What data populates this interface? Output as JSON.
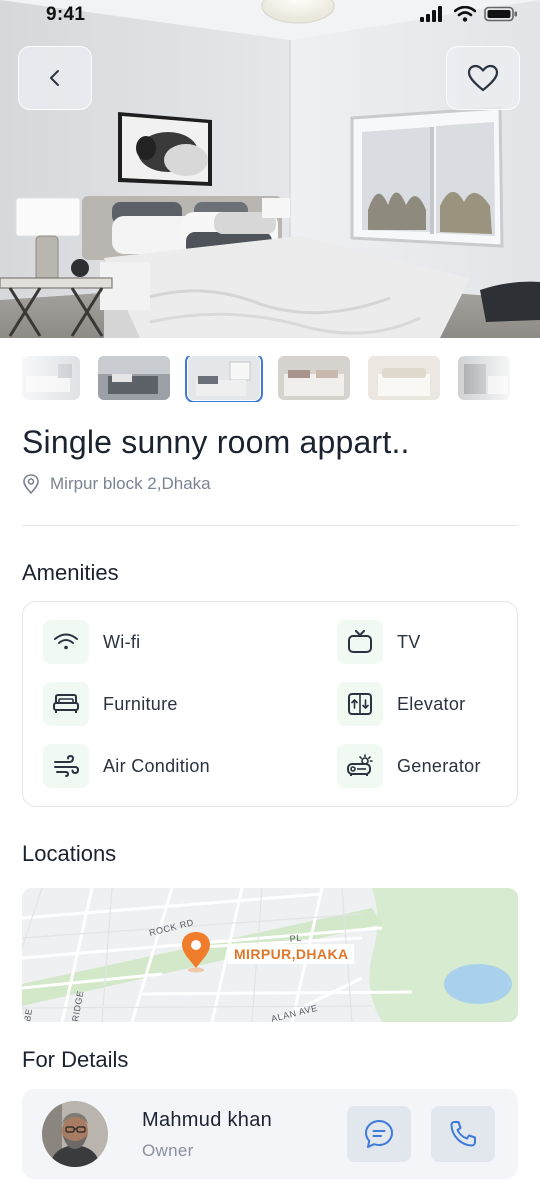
{
  "status": {
    "time": "9:41"
  },
  "listing": {
    "title": "Single sunny room appart..",
    "location": "Mirpur block 2,Dhaka"
  },
  "amenities": {
    "title": "Amenities",
    "items": [
      {
        "label": "Wi-fi",
        "icon": "wifi-icon"
      },
      {
        "label": "TV",
        "icon": "tv-icon"
      },
      {
        "label": "Furniture",
        "icon": "bed-icon"
      },
      {
        "label": "Elevator",
        "icon": "elevator-icon"
      },
      {
        "label": "Air Condition",
        "icon": "wind-icon"
      },
      {
        "label": "Generator",
        "icon": "generator-icon"
      }
    ]
  },
  "locations": {
    "title": "Locations",
    "map_pin_label": "MIRPUR,DHAKA",
    "streets": [
      "ROCK RD",
      "RIDGE",
      "ALAN AVE",
      "PL",
      "BE"
    ]
  },
  "details": {
    "title": "For Details",
    "owner_name": "Mahmud khan",
    "owner_role": "Owner"
  },
  "colors": {
    "accent": "#3d7bd9",
    "pin": "#f07d2c",
    "amenity_bg": "#f1f9f3"
  }
}
